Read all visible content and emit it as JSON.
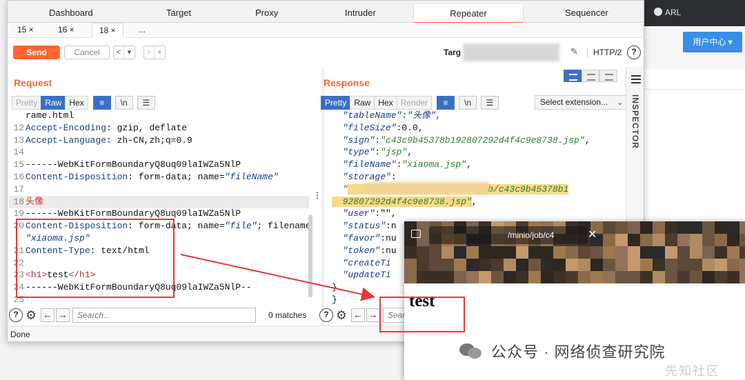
{
  "background_app": {
    "title": "ARL",
    "user_center": "用户中心 ▾"
  },
  "burp": {
    "top_tabs": [
      "Dashboard",
      "Target",
      "Proxy",
      "Intruder",
      "Repeater",
      "Sequencer"
    ],
    "active_top_tab": "Repeater",
    "sub_tabs": [
      "15 ×",
      "16 ×",
      "18 ×",
      "..."
    ],
    "active_sub_tab": "18 ×",
    "toolbar": {
      "send": "Send",
      "cancel": "Cancel",
      "back": "<",
      "back_menu": "▾",
      "forward": ">",
      "forward_menu": "▾",
      "target_label": "Targ",
      "http_version": "HTTP/2",
      "help": "?"
    },
    "request": {
      "title": "Request",
      "view_tabs": [
        "Pretty",
        "Raw",
        "Hex"
      ],
      "active_view": "Raw",
      "lines": [
        {
          "n": "",
          "parts": [
            {
              "t": "rame.html",
              "c": "v"
            }
          ]
        },
        {
          "n": "12",
          "parts": [
            {
              "t": "Accept-Encoding",
              "c": "k"
            },
            {
              "t": ": gzip, deflate",
              "c": "v"
            }
          ]
        },
        {
          "n": "13",
          "parts": [
            {
              "t": "Accept-Language",
              "c": "k"
            },
            {
              "t": ": zh-CN,zh;q=0.9",
              "c": "v"
            }
          ]
        },
        {
          "n": "14",
          "parts": []
        },
        {
          "n": "15",
          "parts": [
            {
              "t": "------WebKitFormBoundaryQ8uq09laIWZa5NlP",
              "c": "v"
            }
          ]
        },
        {
          "n": "16",
          "parts": [
            {
              "t": "Content-Disposition",
              "c": "k"
            },
            {
              "t": ": form-data; name=",
              "c": "v"
            },
            {
              "t": "\"fileName\"",
              "c": "s"
            }
          ]
        },
        {
          "n": "17",
          "parts": []
        },
        {
          "n": "18",
          "parts": [
            {
              "t": "头像",
              "c": "sr"
            }
          ],
          "hl": true
        },
        {
          "n": "19",
          "parts": [
            {
              "t": "------WebKitFormBoundaryQ8uq09laIWZa5NlP",
              "c": "v"
            }
          ]
        },
        {
          "n": "20",
          "parts": [
            {
              "t": "Content-Disposition",
              "c": "k"
            },
            {
              "t": ": form-data; name=",
              "c": "v"
            },
            {
              "t": "\"file\"",
              "c": "s"
            },
            {
              "t": "; filename=",
              "c": "v"
            }
          ]
        },
        {
          "n": "",
          "parts": [
            {
              "t": "\"xiaoma.jsp\"",
              "c": "s"
            }
          ]
        },
        {
          "n": "21",
          "parts": [
            {
              "t": "Content-Type",
              "c": "k"
            },
            {
              "t": ": text/html",
              "c": "v"
            }
          ]
        },
        {
          "n": "22",
          "parts": []
        },
        {
          "n": "23",
          "parts": [
            {
              "t": "<h1>",
              "c": "tag"
            },
            {
              "t": "test",
              "c": "v"
            },
            {
              "t": "</h1>",
              "c": "tag"
            }
          ]
        },
        {
          "n": "24",
          "parts": [
            {
              "t": "------WebKitFormBoundaryQ8uq09laIWZa5NlP--",
              "c": "v"
            }
          ]
        },
        {
          "n": "25",
          "parts": []
        }
      ],
      "search_placeholder": "Search...",
      "matches": "0 matches"
    },
    "response": {
      "title": "Response",
      "view_tabs": [
        "Pretty",
        "Raw",
        "Hex",
        "Render"
      ],
      "active_view": "Pretty",
      "select_extension": "Select extension...",
      "lines": [
        {
          "parts": [
            {
              "t": "  \"tableName\":\"头像\",",
              "c": "jkey"
            }
          ]
        },
        {
          "parts": [
            {
              "t": "  \"fileSize\"",
              "c": "jkey"
            },
            {
              "t": ":0.0,",
              "c": "jnum"
            }
          ]
        },
        {
          "parts": [
            {
              "t": "  \"sign\"",
              "c": "jkey"
            },
            {
              "t": ":",
              "c": "jnum"
            },
            {
              "t": "\"c43c9b45378b192807292d4f4c9e8738.jsp\"",
              "c": "jstr"
            },
            {
              "t": ",",
              "c": "jnum"
            }
          ]
        },
        {
          "parts": [
            {
              "t": "  \"type\"",
              "c": "jkey"
            },
            {
              "t": ":",
              "c": "jnum"
            },
            {
              "t": "\"jsp\"",
              "c": "jstr"
            },
            {
              "t": ",",
              "c": "jnum"
            }
          ]
        },
        {
          "parts": [
            {
              "t": "  \"fileName\"",
              "c": "jkey"
            },
            {
              "t": ":",
              "c": "jnum"
            },
            {
              "t": "\"xiaoma.jsp\"",
              "c": "jstr"
            },
            {
              "t": ",",
              "c": "jnum"
            }
          ]
        },
        {
          "parts": [
            {
              "t": "  \"storage\"",
              "c": "jkey"
            },
            {
              "t": ":",
              "c": "jnum"
            }
          ]
        },
        {
          "parts": [
            {
              "t": "  \"",
              "c": "jstr"
            },
            {
              "t": "                      o/job/c43c9b45378b1",
              "c": "jstr yellowhl"
            }
          ]
        },
        {
          "parts": [
            {
              "t": "  92807292d4f4c9e8738.jsp\"",
              "c": "jstr yellowhl"
            },
            {
              "t": ",",
              "c": "jnum"
            }
          ]
        },
        {
          "parts": [
            {
              "t": "  \"user\"",
              "c": "jkey"
            },
            {
              "t": ":\"\",",
              "c": "jnum"
            }
          ]
        },
        {
          "parts": [
            {
              "t": "  \"status\"",
              "c": "jkey"
            },
            {
              "t": ":n",
              "c": "jnum"
            }
          ]
        },
        {
          "parts": [
            {
              "t": "  \"favor\"",
              "c": "jkey"
            },
            {
              "t": ":nu",
              "c": "jnum"
            }
          ]
        },
        {
          "parts": [
            {
              "t": "  \"token\"",
              "c": "jkey"
            },
            {
              "t": ":nu",
              "c": "jnum"
            }
          ]
        },
        {
          "parts": [
            {
              "t": "  \"createTi",
              "c": "jkey"
            }
          ]
        },
        {
          "parts": [
            {
              "t": "  \"updateTi",
              "c": "jkey"
            }
          ]
        },
        {
          "parts": [
            {
              "t": "}",
              "c": "jnum"
            }
          ]
        },
        {
          "parts": [
            {
              "t": "}",
              "c": "jnum"
            }
          ]
        }
      ]
    },
    "inspector": "INSPECTOR",
    "status": "Done"
  },
  "browser": {
    "url_fragment": "/minio/job/c4",
    "close": "✕",
    "page_heading": "test"
  },
  "watermark": {
    "text": "公众号 · 网络侦查研究院",
    "secondary": "先知社区"
  },
  "colors": {
    "accent": "#ff6633",
    "selected": "#3b6fc4",
    "annotation": "#e53935"
  }
}
